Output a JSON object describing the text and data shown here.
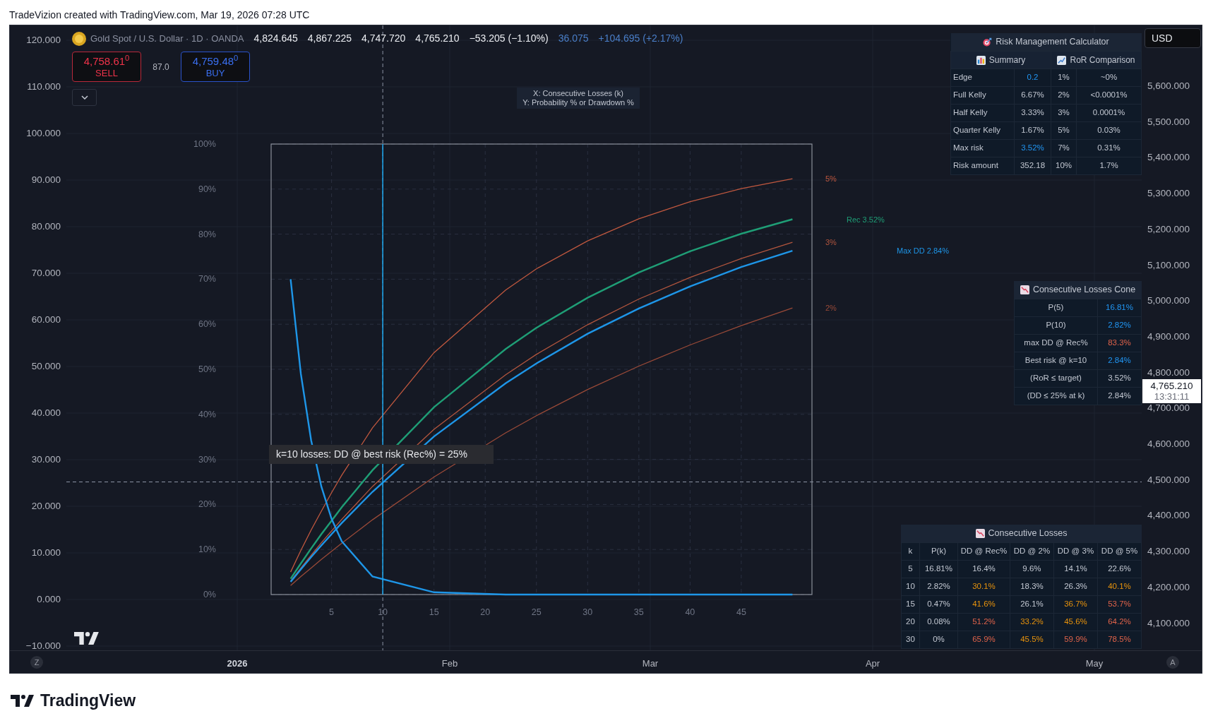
{
  "caption": "TradeVizion created with TradingView.com, Mar 19, 2026 07:28 UTC",
  "legend": {
    "symbol": "Gold Spot / U.S. Dollar · 1D · OANDA",
    "values": [
      "4,824.645",
      "4,867.225",
      "4,747.720",
      "4,765.210",
      "−53.205 (−1.10%)"
    ],
    "indicator_values": [
      "36.075",
      "+104.695 (+2.17%)"
    ]
  },
  "quote": {
    "sell_price": "4,758.61$^{0}$",
    "sell_label": "SELL",
    "spread": "87.0",
    "buy_price": "4,759.48$^{0}$",
    "buy_label": "BUY"
  },
  "left_axis": [
    "120.000",
    "110.000",
    "100.000",
    "90.000",
    "80.000",
    "70.000",
    "60.000",
    "50.000",
    "40.000",
    "30.000",
    "20.000",
    "10.000",
    "0.000",
    "−10.000"
  ],
  "right_axis": [
    "5,600.000",
    "5,500.000",
    "5,400.000",
    "5,300.000",
    "5,200.000",
    "5,100.000",
    "5,000.000",
    "4,900.000",
    "4,800.000",
    "4,700.000",
    "4,600.000",
    "4,500.000",
    "4,400.000",
    "4,300.000",
    "4,200.000",
    "4,100.000"
  ],
  "currency_button": "USD",
  "price_label": {
    "price": "4,765.210",
    "countdown": "13:31:11"
  },
  "time_axis": {
    "labels": [
      {
        "text": "2026",
        "major": true
      },
      {
        "text": "Feb",
        "major": false
      },
      {
        "text": "Mar",
        "major": false
      },
      {
        "text": "Apr",
        "major": false
      },
      {
        "text": "May",
        "major": false
      }
    ],
    "left_button": "Z",
    "right_button": "A"
  },
  "axis_note": [
    "X: Consecutive Losses (k)",
    "Y: Probability % or Drawdown %"
  ],
  "chart_data": {
    "type": "line",
    "x": [
      1,
      2,
      3,
      4,
      5,
      6,
      9,
      15,
      22,
      25,
      30,
      35,
      40,
      45,
      50
    ],
    "xlim": [
      -0.9,
      51.9
    ],
    "ylim": [
      0,
      100
    ],
    "xticks": [
      5,
      10,
      15,
      20,
      25,
      30,
      35,
      40,
      45
    ],
    "grid": true,
    "ref_lines": [
      {
        "axis": "x",
        "value": 10,
        "color": "#1aa6ee"
      }
    ],
    "yticks": [
      {
        "value": 0,
        "label": "0%"
      },
      {
        "value": 10,
        "label": "10%"
      },
      {
        "value": 20,
        "label": "20%"
      },
      {
        "value": 30,
        "label": "30%"
      },
      {
        "value": 40,
        "label": "40%"
      },
      {
        "value": 50,
        "label": "50%"
      },
      {
        "value": 60,
        "label": "60%"
      },
      {
        "value": 70,
        "label": "70%"
      },
      {
        "value": 80,
        "label": "80%"
      },
      {
        "value": 90,
        "label": "90%"
      },
      {
        "value": 100,
        "label": "100%"
      }
    ],
    "series": [
      {
        "name": "5%",
        "color": "#c0583f",
        "values": [
          5.0,
          9.8,
          14.3,
          18.5,
          22.6,
          26.5,
          37.0,
          53.7,
          67.6,
          72.3,
          78.5,
          83.4,
          87.2,
          90.1,
          92.3
        ]
      },
      {
        "name": "Rec 3.52%",
        "color": "#1f9e76",
        "values": [
          3.5,
          6.9,
          10.2,
          13.4,
          16.4,
          19.4,
          27.6,
          41.6,
          54.5,
          59.2,
          65.9,
          71.5,
          76.2,
          80.1,
          83.3
        ]
      },
      {
        "name": "3%",
        "color": "#b4563e",
        "values": [
          3.0,
          5.9,
          8.7,
          11.5,
          14.1,
          16.7,
          24.0,
          36.7,
          48.8,
          53.3,
          59.9,
          65.6,
          70.4,
          74.6,
          78.2
        ]
      },
      {
        "name": "Max DD 2.84%",
        "color": "#1e96e8",
        "values": [
          2.8,
          5.6,
          8.3,
          10.9,
          13.4,
          15.9,
          22.8,
          35.1,
          46.9,
          51.3,
          57.9,
          63.5,
          68.4,
          72.7,
          76.3
        ]
      },
      {
        "name": "2%",
        "color": "#9a4a38",
        "values": [
          2.0,
          4.0,
          5.9,
          7.8,
          9.6,
          11.4,
          16.6,
          26.1,
          35.9,
          39.7,
          45.5,
          50.7,
          55.4,
          59.7,
          63.6
        ]
      },
      {
        "color": "#1e96e8",
        "values": [
          70.0,
          49.0,
          34.3,
          24.0,
          16.8,
          11.8,
          4.0,
          0.5,
          0.0,
          0.0,
          0.0,
          0.0,
          0.0,
          0.0,
          0.0
        ]
      }
    ],
    "annotations": [
      "k=10 losses: DD @ best risk (Rec%) = 25%"
    ]
  },
  "risk_calculator": {
    "title": "Risk Management Calculator",
    "sections": [
      "Summary",
      "RoR Comparison"
    ],
    "rows": [
      [
        "Edge",
        {
          "text": "0.2",
          "color": "#2196f3"
        },
        "1%",
        "~0%"
      ],
      [
        "Full Kelly",
        "6.67%",
        "2%",
        "<0.0001%"
      ],
      [
        "Half Kelly",
        "3.33%",
        "3%",
        "0.0001%"
      ],
      [
        "Quarter Kelly",
        "1.67%",
        "5%",
        "0.03%"
      ],
      [
        "Max risk",
        {
          "text": "3.52%",
          "color": "#2196f3"
        },
        "7%",
        "0.31%"
      ],
      [
        "Risk amount",
        "352.18",
        "10%",
        "1.7%"
      ]
    ]
  },
  "cone_table": {
    "title": "Consecutive Losses Cone",
    "rows": [
      [
        "P(5)",
        {
          "text": "16.81%",
          "color": "#2196f3"
        }
      ],
      [
        "P(10)",
        {
          "text": "2.82%",
          "color": "#2196f3"
        }
      ],
      [
        "max DD @ Rec%",
        {
          "text": "83.3%",
          "color": "#e0634a"
        }
      ],
      [
        "Best risk @ k=10",
        {
          "text": "2.84%",
          "color": "#2196f3"
        }
      ],
      [
        "(RoR ≤ target)",
        "3.52%"
      ],
      [
        "(DD ≤ 25% at k)",
        "2.84%"
      ]
    ]
  },
  "losses_table": {
    "title": "Consecutive Losses",
    "columns": [
      "k",
      "P(k)",
      "DD @ Rec%",
      "DD @ 2%",
      "DD @ 3%",
      "DD @ 5%"
    ],
    "rows": [
      [
        "5",
        "16.81%",
        "16.4%",
        "9.6%",
        "14.1%",
        "22.6%"
      ],
      [
        "10",
        "2.82%",
        {
          "text": "30.1%",
          "color": "#e8930c"
        },
        "18.3%",
        "26.3%",
        {
          "text": "40.1%",
          "color": "#e8930c"
        }
      ],
      [
        "15",
        "0.47%",
        {
          "text": "41.6%",
          "color": "#e8930c"
        },
        "26.1%",
        {
          "text": "36.7%",
          "color": "#e8930c"
        },
        {
          "text": "53.7%",
          "color": "#e0634a"
        }
      ],
      [
        "20",
        "0.08%",
        {
          "text": "51.2%",
          "color": "#e0634a"
        },
        {
          "text": "33.2%",
          "color": "#e8930c"
        },
        {
          "text": "45.6%",
          "color": "#e8930c"
        },
        {
          "text": "64.2%",
          "color": "#e0634a"
        }
      ],
      [
        "30",
        "0%",
        {
          "text": "65.9%",
          "color": "#e0634a"
        },
        {
          "text": "45.5%",
          "color": "#e8930c"
        },
        {
          "text": "59.9%",
          "color": "#e0634a"
        },
        {
          "text": "78.5%",
          "color": "#e0634a"
        }
      ]
    ]
  },
  "footer": {
    "brand": "TradingView"
  }
}
